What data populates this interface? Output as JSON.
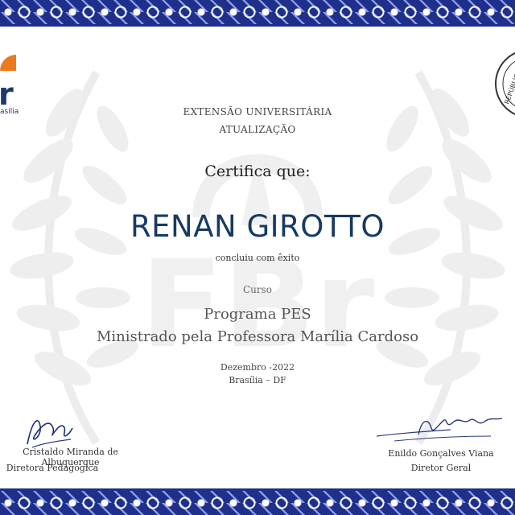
{
  "certificate": {
    "program_type": "EXTENSÃO UNIVERSITÁRIA",
    "program_level": "ATUALIZAÇÃO",
    "certifies": "Certifica que:",
    "recipient": "RENAN GIROTTO",
    "completion": "concluiu com êxito",
    "course_label": "Curso",
    "course_name": "Programa PES",
    "instructor": "Ministrado pela Professora Marília Cardoso",
    "date": "Dezembro -2022",
    "location": "Brasília – DF"
  },
  "logo": {
    "mark": "r",
    "caption": "asília"
  },
  "seal": {
    "text": "REPÚBLICA"
  },
  "signatures": {
    "left": {
      "name": "Cristaldo Miranda de Albuquerque",
      "role": "Diretora Pedagógica"
    },
    "right": {
      "name": "Enildo Gonçalves Viana",
      "role": "Diretor Geral"
    }
  },
  "colors": {
    "border": "#1f2f8c",
    "name": "#173a64",
    "logo_orange": "#e97b1e"
  }
}
